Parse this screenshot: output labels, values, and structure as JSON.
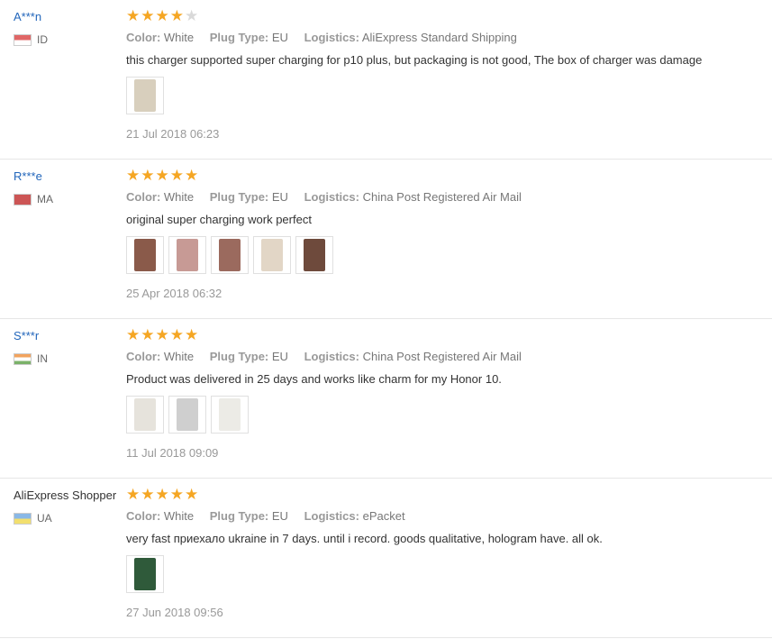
{
  "labels": {
    "color": "Color:",
    "plug": "Plug Type:",
    "logistics": "Logistics:"
  },
  "reviews": [
    {
      "user": "A***n",
      "country": "ID",
      "rating": 4,
      "color": "White",
      "plug": "EU",
      "logistics": "AliExpress Standard Shipping",
      "comment": "this charger supported super charging for p10 plus, but packaging is not good, The box of charger was damage",
      "photos": [
        "#d8cfbd"
      ],
      "date": "21 Jul 2018 06:23"
    },
    {
      "user": "R***e",
      "country": "MA",
      "rating": 5,
      "color": "White",
      "plug": "EU",
      "logistics": "China Post Registered Air Mail",
      "comment": "original super charging work perfect",
      "photos": [
        "#8a5a4a",
        "#c79a95",
        "#9b6a5e",
        "#e2d6c6",
        "#6e4a3c"
      ],
      "date": "25 Apr 2018 06:32"
    },
    {
      "user": "S***r",
      "country": "IN",
      "rating": 5,
      "color": "White",
      "plug": "EU",
      "logistics": "China Post Registered Air Mail",
      "comment": "Product was delivered in 25 days and works like charm for my Honor 10.",
      "photos": [
        "#e6e3dc",
        "#cfcfcf",
        "#ecebe6"
      ],
      "date": "11 Jul 2018 09:09"
    },
    {
      "user": "AliExpress Shopper",
      "country": "UA",
      "rating": 5,
      "color": "White",
      "plug": "EU",
      "logistics": "ePacket",
      "comment": "very fast приехало ukraine in 7 days. until i record. goods qualitative, hologram have. all ok.",
      "photos": [
        "#2f5a3a"
      ],
      "date": "27 Jun 2018 09:56"
    }
  ]
}
